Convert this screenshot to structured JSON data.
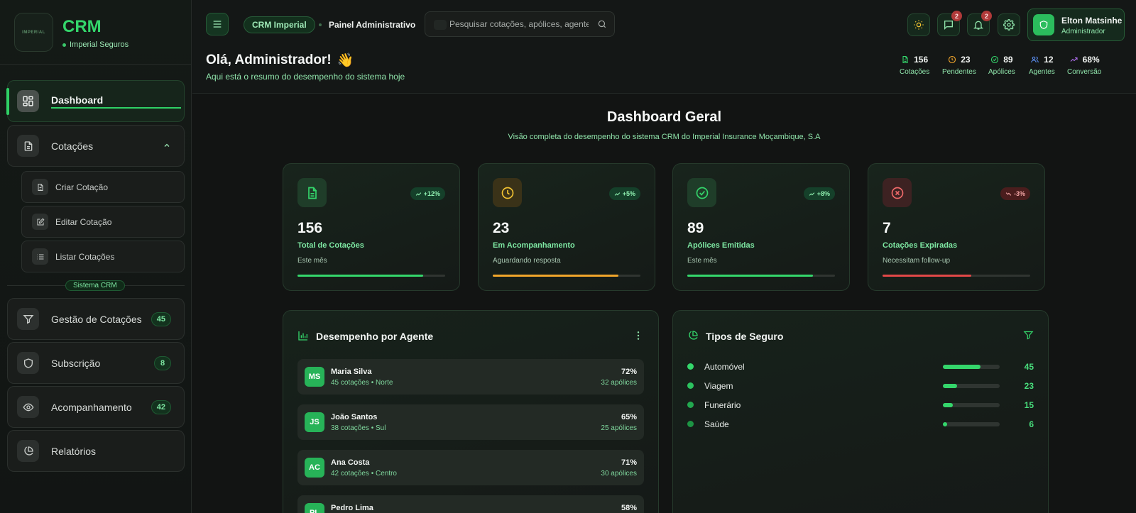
{
  "brand": {
    "logo_text": "IMPERIAL",
    "title": "CRM",
    "subtitle": "Imperial Seguros"
  },
  "sidebar": {
    "items": [
      {
        "label": "Dashboard"
      },
      {
        "label": "Cotações"
      },
      {
        "label": "Gestão de Cotações",
        "badge": "45"
      },
      {
        "label": "Subscrição",
        "badge": "8"
      },
      {
        "label": "Acompanhamento",
        "badge": "42"
      },
      {
        "label": "Relatórios"
      }
    ],
    "sub_items": [
      {
        "label": "Criar Cotação"
      },
      {
        "label": "Editar Cotação"
      },
      {
        "label": "Listar Cotações"
      }
    ],
    "section_tag": "Sistema CRM"
  },
  "topbar": {
    "crm_pill": "CRM Imperial",
    "page_title": "Painel Administrativo",
    "search_placeholder": "Pesquisar cotações, apólices, agentes...",
    "messages_badge": "2",
    "notifications_badge": "2",
    "user": {
      "name": "Elton Matsinhe",
      "role": "Administrador"
    }
  },
  "greeting": {
    "title": "Olá, Administrador!",
    "emoji": "👋",
    "subtitle": "Aqui está o resumo do desempenho do sistema hoje"
  },
  "mini_stats": [
    {
      "value": "156",
      "label": "Cotações",
      "icon": "document-icon",
      "color": "#34d66b"
    },
    {
      "value": "23",
      "label": "Pendentes",
      "icon": "clock-icon",
      "color": "#f1a52b"
    },
    {
      "value": "89",
      "label": "Apólices",
      "icon": "check-circle-icon",
      "color": "#34d66b"
    },
    {
      "value": "12",
      "label": "Agentes",
      "icon": "users-icon",
      "color": "#5b8ff2"
    },
    {
      "value": "68%",
      "label": "Conversão",
      "icon": "trend-icon",
      "color": "#b06ff0"
    }
  ],
  "main": {
    "title": "Dashboard Geral",
    "subtitle": "Visão completa do desempenho do sistema CRM do Imperial Insurance Moçambique, S.A"
  },
  "kpis": [
    {
      "value": "156",
      "label": "Total de Cotações",
      "sub": "Este mês",
      "trend": "+12%",
      "direction": "up",
      "progress": 0.85,
      "color": "#34d66b"
    },
    {
      "value": "23",
      "label": "Em Acompanhamento",
      "sub": "Aguardando resposta",
      "trend": "+5%",
      "direction": "up",
      "progress": 0.85,
      "color": "#f1a52b"
    },
    {
      "value": "89",
      "label": "Apólices Emitidas",
      "sub": "Este mês",
      "trend": "+8%",
      "direction": "up",
      "progress": 0.85,
      "color": "#34d66b"
    },
    {
      "value": "7",
      "label": "Cotações Expiradas",
      "sub": "Necessitam follow-up",
      "trend": "-3%",
      "direction": "down",
      "progress": 0.6,
      "color": "#e24848"
    }
  ],
  "agents_panel": {
    "title": "Desempenho por Agente",
    "agents": [
      {
        "initials": "MS",
        "name": "Maria Silva",
        "meta": "45 cotações • Norte",
        "pct": "72%",
        "policies": "32 apólices"
      },
      {
        "initials": "JS",
        "name": "João Santos",
        "meta": "38 cotações • Sul",
        "pct": "65%",
        "policies": "25 apólices"
      },
      {
        "initials": "AC",
        "name": "Ana Costa",
        "meta": "42 cotações • Centro",
        "pct": "71%",
        "policies": "30 apólices"
      },
      {
        "initials": "PL",
        "name": "Pedro Lima",
        "meta": "",
        "pct": "58%",
        "policies": ""
      }
    ]
  },
  "types_panel": {
    "title": "Tipos de Seguro",
    "types": [
      {
        "name": "Automóvel",
        "count": "45",
        "fraction": 0.66,
        "dot": "#34d66b"
      },
      {
        "name": "Viagem",
        "count": "23",
        "fraction": 0.25,
        "dot": "#2cc25f"
      },
      {
        "name": "Funerário",
        "count": "15",
        "fraction": 0.17,
        "dot": "#22a84f"
      },
      {
        "name": "Saúde",
        "count": "6",
        "fraction": 0.07,
        "dot": "#1d9444"
      }
    ]
  }
}
